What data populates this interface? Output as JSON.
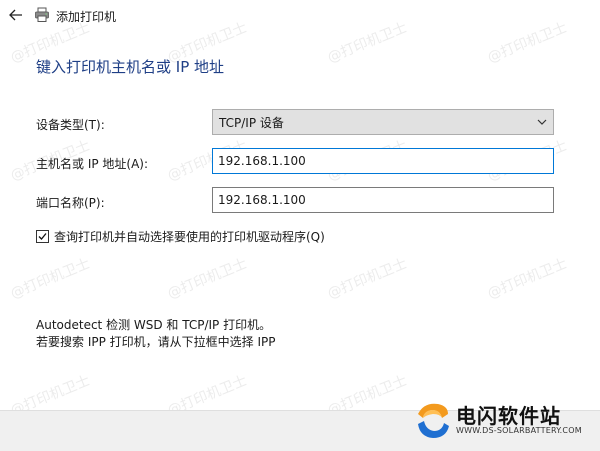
{
  "window": {
    "title": "添加打印机"
  },
  "heading": "键入打印机主机名或 IP 地址",
  "form": {
    "device_type_label": "设备类型(T):",
    "device_type_value": "TCP/IP 设备",
    "hostname_label": "主机名或 IP 地址(A):",
    "hostname_value": "192.168.1.100",
    "port_label": "端口名称(P):",
    "port_value": "192.168.1.100",
    "query_printer_label": "查询打印机并自动选择要使用的打印机驱动程序(Q)",
    "query_printer_checked": true
  },
  "info": {
    "line1": "Autodetect 检测 WSD 和 TCP/IP 打印机。",
    "line2": "若要搜索 IPP 打印机，请从下拉框中选择 IPP"
  },
  "watermark": "@打印机卫士",
  "brand": {
    "name": "电闪软件站",
    "url": "WWW.DS-SOLARBATTERY.COM"
  },
  "icons": {
    "back": "back-arrow-icon",
    "printer": "printer-icon",
    "dropdown": "chevron-down-icon",
    "check": "checkmark-icon"
  },
  "colors": {
    "heading": "#1f3f86",
    "focus_border": "#0078d7",
    "brand_orange": "#f39a1e",
    "brand_blue": "#1f6fd1"
  }
}
